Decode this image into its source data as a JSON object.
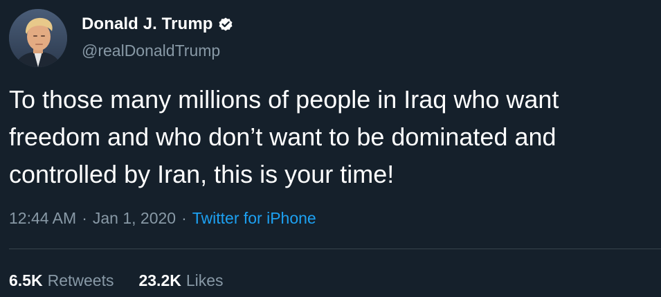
{
  "user": {
    "display_name": "Donald J. Trump",
    "handle": "@realDonaldTrump",
    "verified": true,
    "avatar_icon": "profile-photo"
  },
  "tweet": {
    "text": "To those many millions of people in Iraq who want\nfreedom and who don’t want to be dominated and\ncontrolled by Iran, this is your time!",
    "time": "12:44 AM",
    "date": "Jan 1, 2020",
    "separator": "·",
    "source": "Twitter for iPhone"
  },
  "stats": {
    "retweets_count": "6.5K",
    "retweets_label": "Retweets",
    "likes_count": "23.2K",
    "likes_label": "Likes"
  },
  "colors": {
    "background": "#15202b",
    "text": "#ffffff",
    "secondary_text": "#8899a6",
    "link": "#1da1f2",
    "divider": "#38444d"
  }
}
